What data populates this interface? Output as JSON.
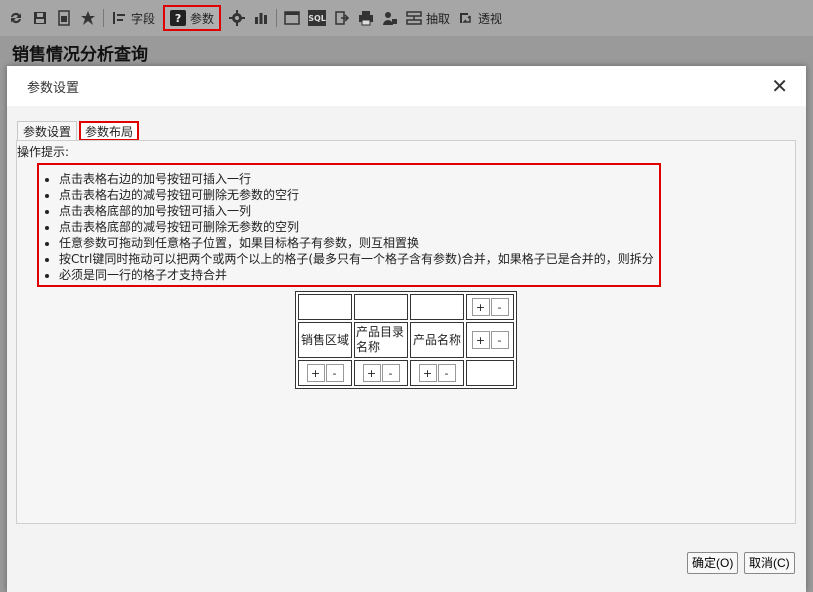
{
  "toolbar": {
    "items": [
      {
        "icon": "refresh-icon"
      },
      {
        "icon": "save-icon"
      },
      {
        "icon": "save-as-icon"
      },
      {
        "icon": "favorite-star-icon"
      },
      {
        "icon": "fields-icon",
        "label": "字段"
      },
      {
        "icon": "parameter-icon",
        "label": "参数"
      },
      {
        "icon": "settings-gear-icon"
      },
      {
        "icon": "bar-chart-icon"
      },
      {
        "icon": "report-icon"
      },
      {
        "icon": "sql-icon"
      },
      {
        "icon": "export-icon"
      },
      {
        "icon": "print-icon"
      },
      {
        "icon": "user-permission-icon"
      },
      {
        "icon": "extract-icon",
        "label": "抽取"
      },
      {
        "icon": "pivot-icon",
        "label": "透视"
      }
    ]
  },
  "page": {
    "title": "销售情况分析查询"
  },
  "dialog": {
    "title": "参数设置",
    "tabs": [
      {
        "label": "参数设置"
      },
      {
        "label": "参数布局"
      }
    ],
    "hint_label": "操作提示:",
    "hints": [
      "点击表格右边的加号按钮可插入一行",
      "点击表格右边的减号按钮可删除无参数的空行",
      "点击表格底部的加号按钮可插入一列",
      "点击表格底部的减号按钮可删除无参数的空列",
      "任意参数可拖动到任意格子位置，如果目标格子有参数，则互相置换",
      "按Ctrl键同时拖动可以把两个或两个以上的格子(最多只有一个格子含有参数)合并，如果格子已是合并的，则拆分",
      "必须是同一行的格子才支持合并"
    ],
    "grid": {
      "row2": [
        "销售区域",
        "产品目录名称",
        "产品名称"
      ],
      "plus": "+",
      "minus": "-"
    },
    "buttons": {
      "ok": "确定(O)",
      "cancel": "取消(C)"
    }
  },
  "colors": {
    "highlight": "#e00000"
  }
}
